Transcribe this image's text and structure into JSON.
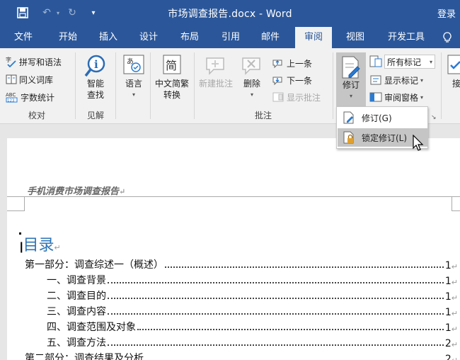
{
  "titlebar": {
    "title": "市场调查报告.docx - Word",
    "login": "登录"
  },
  "tabs": [
    {
      "label": "文件"
    },
    {
      "label": "开始"
    },
    {
      "label": "插入"
    },
    {
      "label": "设计"
    },
    {
      "label": "布局"
    },
    {
      "label": "引用"
    },
    {
      "label": "邮件"
    },
    {
      "label": "审阅"
    },
    {
      "label": "视图"
    },
    {
      "label": "开发工具"
    }
  ],
  "ribbon": {
    "proofing": {
      "spelling": "拼写和语法",
      "thesaurus": "同义词库",
      "wordcount": "字数统计",
      "group_label": "校对"
    },
    "insights": {
      "smart_lookup_line1": "智能",
      "smart_lookup_line2": "查找",
      "group_label": "见解"
    },
    "language": {
      "label": "语言"
    },
    "chinese": {
      "line1": "中文简繁",
      "line2": "转换"
    },
    "comments": {
      "new_comment": "新建批注",
      "delete": "删除",
      "previous": "上一条",
      "next": "下一条",
      "show_comments": "显示批注",
      "group_label": "批注"
    },
    "tracking": {
      "track_changes": "修订",
      "all_markup": "所有标记",
      "show_markup": "显示标记",
      "reviewing_pane": "审阅窗格"
    },
    "accept_partial": "接"
  },
  "menu": {
    "items": [
      {
        "label": "修订(G)"
      },
      {
        "label": "锁定修订(L)"
      }
    ]
  },
  "document": {
    "header_text": "手机消费市场调查报告",
    "toc_heading": "目录",
    "toc": [
      {
        "text": "第一部分：调查综述一（概述）",
        "page": "1"
      },
      {
        "text": "一、调查背景",
        "page": "1"
      },
      {
        "text": "二、调查目的",
        "page": "1"
      },
      {
        "text": "三、调查内容",
        "page": "1"
      },
      {
        "text": "四、调查范围及对象",
        "page": "1"
      },
      {
        "text": "五、调查方法",
        "page": "2"
      },
      {
        "text": "第二部分：调查结果及分析",
        "page": "2"
      }
    ]
  },
  "colors": {
    "title_bar": "#2b579a",
    "ribbon": "#f1f1f1",
    "heading_blue": "#2e74b5"
  }
}
